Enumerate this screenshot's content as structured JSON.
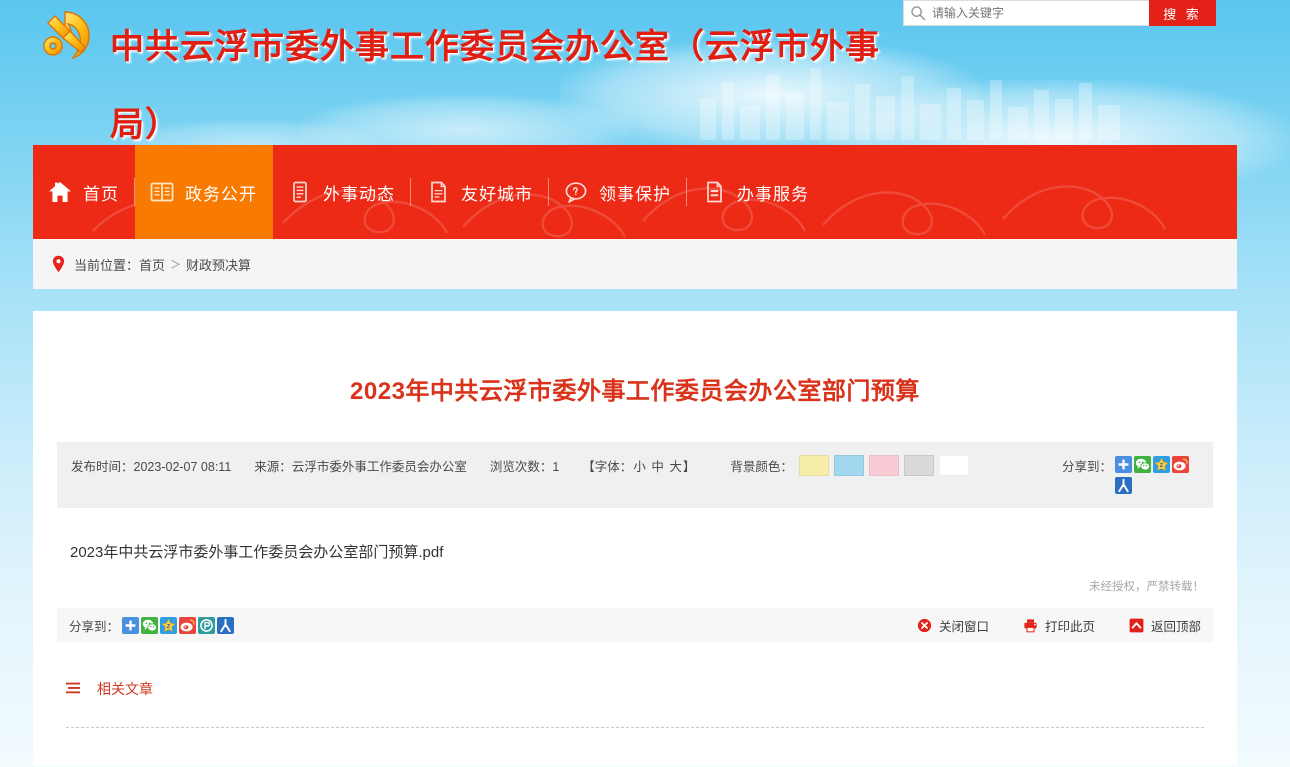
{
  "header": {
    "emblem_icon": "cpc-emblem-icon",
    "title": "中共云浮市委外事工作委员会办公室（云浮市外事局）",
    "search": {
      "icon": "search-icon",
      "placeholder": "请输入关键字",
      "value": "",
      "button_label": "搜 索",
      "button_color": "#e32119"
    }
  },
  "nav": {
    "background": "#ec2a16",
    "active_background": "#f87a00",
    "items": [
      {
        "label": "首页",
        "icon": "home-icon",
        "active": false
      },
      {
        "label": "政务公开",
        "icon": "book-icon",
        "active": true
      },
      {
        "label": "外事动态",
        "icon": "document-icon",
        "active": false
      },
      {
        "label": "友好城市",
        "icon": "page-icon",
        "active": false
      },
      {
        "label": "领事保护",
        "icon": "speech-bubble-icon",
        "active": false
      },
      {
        "label": "办事服务",
        "icon": "form-icon",
        "active": false
      }
    ]
  },
  "breadcrumb": {
    "icon": "location-pin-icon",
    "prefix": "当前位置：",
    "home": "首页",
    "separator": "＞",
    "current": "财政预决算"
  },
  "article": {
    "title": "2023年中共云浮市委外事工作委员会办公室部门预算",
    "title_color": "#d9341b",
    "meta": {
      "publish_label": "发布时间：",
      "publish_time": "2023-02-07 08:11",
      "source_label": "来源：",
      "source": "云浮市委外事工作委员会办公室",
      "views_label": "浏览次数：",
      "views": "1",
      "font_prefix": "【字体：",
      "font_small": "小",
      "font_medium": "中",
      "font_large": "大",
      "font_suffix": "】",
      "bg_label": "背景颜色：",
      "bg_swatches": [
        "#f7eeaa",
        "#a2d8ef",
        "#f9ccd5",
        "#d9d9d9",
        "#ffffff"
      ],
      "share_label": "分享到：",
      "share_icons": [
        "jiathis-plus-icon",
        "wechat-icon",
        "qzone-icon",
        "weibo-icon",
        "renren-icon"
      ]
    },
    "attachment": "2023年中共云浮市委外事工作委员会办公室部门预算.pdf",
    "copyright_notice": "未经授权，严禁转载！"
  },
  "bottom_bar": {
    "share_label": "分享到：",
    "share_icons": [
      "jiathis-plus-icon",
      "wechat-icon",
      "qzone-icon",
      "weibo-icon",
      "douban-icon",
      "renren-icon"
    ],
    "actions": [
      {
        "label": "关闭窗口",
        "icon": "close-circle-icon"
      },
      {
        "label": "打印此页",
        "icon": "printer-icon"
      },
      {
        "label": "返回顶部",
        "icon": "arrow-up-icon"
      }
    ]
  },
  "related": {
    "icon": "list-lines-icon",
    "label": "相关文章",
    "items": []
  }
}
